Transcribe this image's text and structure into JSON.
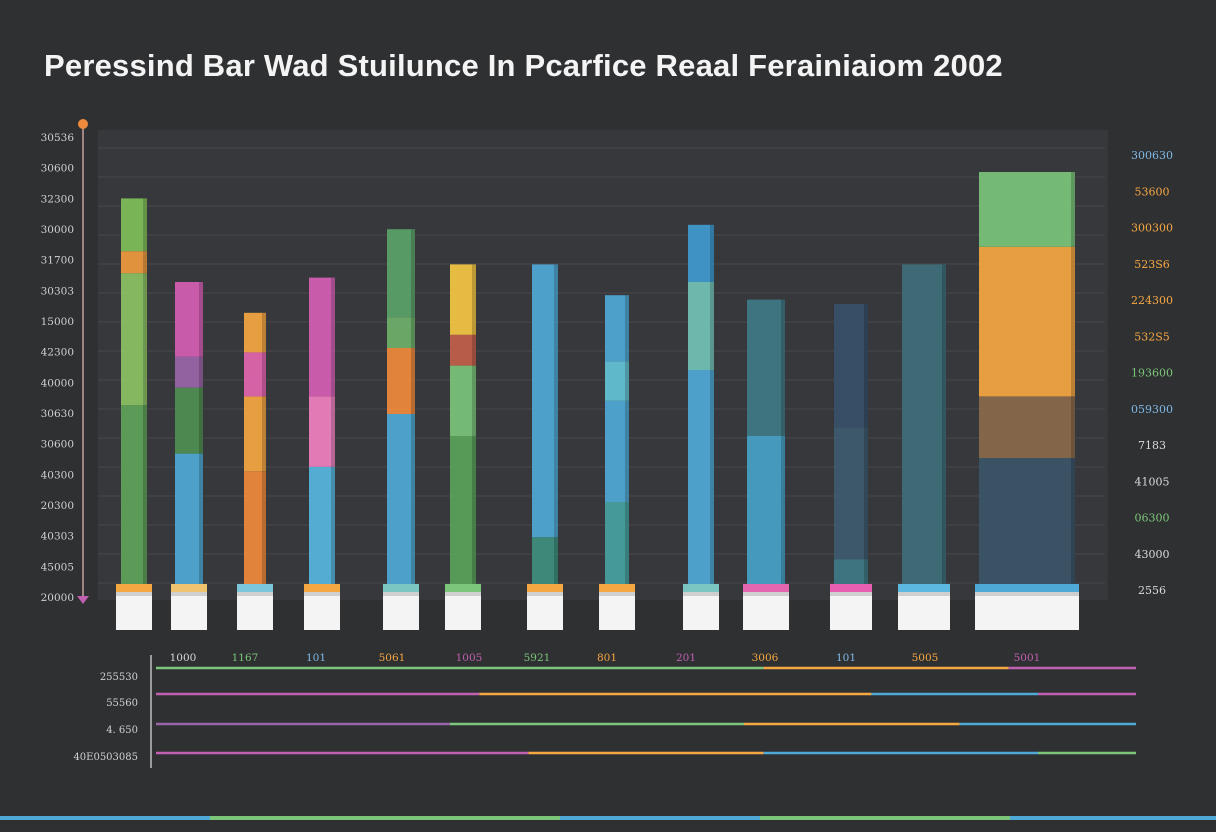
{
  "title": "Peressind Bar Wad Stuilunce In Pcarfice Reaal Ferainiaiom 2002",
  "chart_data": {
    "type": "bar",
    "title": "Peressind Bar Wad Stuilunce In Pcarfice Reaal Ferainiaiom 2002",
    "ylim": [
      0,
      100
    ],
    "grid": true,
    "left_axis_ticks": [
      "30536",
      "30600",
      "32300",
      "30000",
      "31700",
      "30303",
      "15000",
      "42300",
      "40000",
      "30630",
      "30600",
      "40300",
      "20300",
      "40303",
      "45005",
      "20000"
    ],
    "right_axis_ticks": [
      {
        "label": "300630",
        "color": "#7fb8e6"
      },
      {
        "label": "53600",
        "color": "#f5a742"
      },
      {
        "label": "300300",
        "color": "#f5a742"
      },
      {
        "label": "523S6",
        "color": "#f5a742"
      },
      {
        "label": "224300",
        "color": "#f5a742"
      },
      {
        "label": "532S5",
        "color": "#f5a742"
      },
      {
        "label": "193600",
        "color": "#7bc67a"
      },
      {
        "label": "059300",
        "color": "#7fb8e6"
      },
      {
        "label": "7183",
        "color": "#d9d9d9"
      },
      {
        "label": "41005",
        "color": "#d9d9d9"
      },
      {
        "label": "06300",
        "color": "#7bc67a"
      },
      {
        "label": "43000",
        "color": "#d9d9d9"
      },
      {
        "label": "2556",
        "color": "#d9d9d9"
      }
    ],
    "categories": [
      "1000",
      "1167",
      "101",
      "5061",
      "1005",
      "5921",
      "801",
      "201",
      "3006",
      "101",
      "5005",
      "5001"
    ],
    "category_colors": [
      "#d9d9d9",
      "#7bc67a",
      "#7fb8e6",
      "#f5a742",
      "#c15fb0",
      "#7bc67a",
      "#f5a742",
      "#c15fb0",
      "#f5a742",
      "#7fb8e6",
      "#f5a742",
      "#c15fb0"
    ],
    "bars": [
      {
        "segments": [
          {
            "value": 42,
            "color": "#5fa35a"
          },
          {
            "value": 30,
            "color": "#8cc265"
          },
          {
            "value": 5,
            "color": "#f09a3e"
          },
          {
            "value": 12,
            "color": "#7fbf5a"
          }
        ],
        "cap": "#f5a742"
      },
      {
        "segments": [
          {
            "value": 31,
            "color": "#4ea9d6"
          },
          {
            "value": 15,
            "color": "#4f8f52"
          },
          {
            "value": 7,
            "color": "#9a65a8"
          },
          {
            "value": 17,
            "color": "#d65fb4"
          }
        ],
        "cap": "#f0c36e"
      },
      {
        "segments": [
          {
            "value": 27,
            "color": "#f08a3c"
          },
          {
            "value": 17,
            "color": "#f5a742"
          },
          {
            "value": 10,
            "color": "#e466b0"
          },
          {
            "value": 9,
            "color": "#f5a742"
          }
        ],
        "cap": "#7bc6d8"
      },
      {
        "segments": [
          {
            "value": 28,
            "color": "#58b6e0"
          },
          {
            "value": 16,
            "color": "#f080c0"
          },
          {
            "value": 27,
            "color": "#d65fb4"
          }
        ],
        "cap": "#f5a742"
      },
      {
        "segments": [
          {
            "value": 40,
            "color": "#4ea9d6"
          },
          {
            "value": 15,
            "color": "#f08a3c"
          },
          {
            "value": 7,
            "color": "#6fb06a"
          },
          {
            "value": 20,
            "color": "#5aa36a"
          }
        ],
        "cap": "#7bc6c2"
      },
      {
        "segments": [
          {
            "value": 35,
            "color": "#5aa35a"
          },
          {
            "value": 16,
            "color": "#7bc67a"
          },
          {
            "value": 7,
            "color": "#c2604a"
          },
          {
            "value": 16,
            "color": "#f5c742"
          }
        ],
        "cap": "#7bc67a"
      },
      {
        "segments": [
          {
            "value": 12,
            "color": "#3f8f7f"
          },
          {
            "value": 62,
            "color": "#4ea9d6"
          }
        ],
        "cap": "#f5a742"
      },
      {
        "segments": [
          {
            "value": 20,
            "color": "#47a39f"
          },
          {
            "value": 23,
            "color": "#4ea9d6"
          },
          {
            "value": 9,
            "color": "#63c3d6"
          },
          {
            "value": 15,
            "color": "#4ea9d6"
          }
        ],
        "cap": "#f5a742"
      },
      {
        "segments": [
          {
            "value": 50,
            "color": "#4ea9d6"
          },
          {
            "value": 20,
            "color": "#72c2b6"
          },
          {
            "value": 13,
            "color": "#3f9ad0"
          }
        ],
        "cap": "#7bc6c2"
      },
      {
        "segments": [
          {
            "value": 35,
            "color": "#46a3c8"
          },
          {
            "value": 31,
            "color": "#3f7a86"
          }
        ],
        "cap": "#e466b0"
      },
      {
        "segments": [
          {
            "value": 7,
            "color": "#3f7a86"
          },
          {
            "value": 30,
            "color": "#3e5a70"
          },
          {
            "value": 28,
            "color": "#38506a"
          }
        ],
        "cap": "#e85fb2"
      },
      {
        "segments": [
          {
            "value": 74,
            "color": "#3f6f7c"
          }
        ],
        "cap": "#5cb8e0"
      },
      {
        "segments": [
          {
            "value": 30,
            "color": "#3b5568"
          },
          {
            "value": 14,
            "color": "#8a6a4c"
          },
          {
            "value": 34,
            "color": "#f5a742"
          },
          {
            "value": 17,
            "color": "#7bc67a"
          }
        ],
        "cap": "#4ea9d6"
      }
    ],
    "lower_axis_ticks": [
      "255530",
      "55560",
      "4. 650",
      "40E0503085"
    ],
    "lower_lines": [
      [
        {
          "value": 0.62,
          "color": "#7bc67a"
        },
        {
          "value": 0.25,
          "color": "#f5a742"
        },
        {
          "value": 0.13,
          "color": "#c15fb0"
        }
      ],
      [
        {
          "value": 0.33,
          "color": "#c15fb0"
        },
        {
          "value": 0.4,
          "color": "#f5a742"
        },
        {
          "value": 0.17,
          "color": "#4ea9d6"
        },
        {
          "value": 0.1,
          "color": "#c15fb0"
        }
      ],
      [
        {
          "value": 0.3,
          "color": "#9a65a8"
        },
        {
          "value": 0.3,
          "color": "#7bc67a"
        },
        {
          "value": 0.22,
          "color": "#f5a742"
        },
        {
          "value": 0.18,
          "color": "#4ea9d6"
        }
      ],
      [
        {
          "value": 0.38,
          "color": "#c15fb0"
        },
        {
          "value": 0.24,
          "color": "#f5a742"
        },
        {
          "value": 0.28,
          "color": "#4ea9d6"
        },
        {
          "value": 0.1,
          "color": "#7bc67a"
        }
      ]
    ]
  }
}
